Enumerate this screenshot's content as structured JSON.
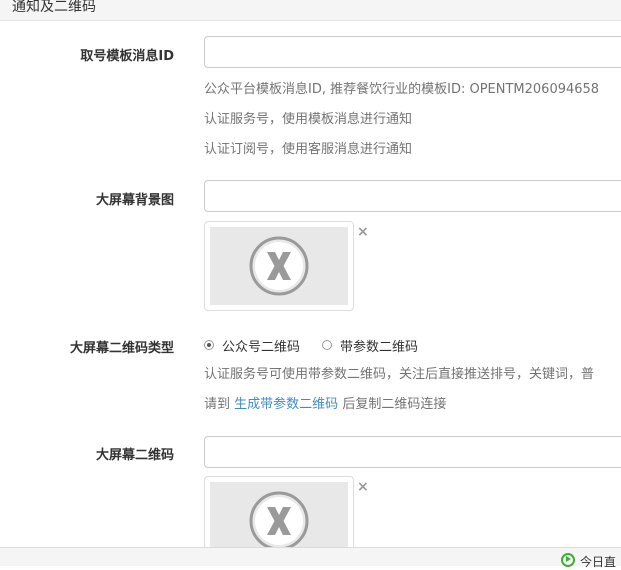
{
  "section": {
    "title": "通知及二维码"
  },
  "template_id": {
    "label": "取号模板消息ID",
    "value": "",
    "help1": "公众平台模板消息ID, 推荐餐饮行业的模板ID: OPENTM206094658",
    "help2": "认证服务号，使用模板消息进行通知",
    "help3": "认证订阅号，使用客服消息进行通知"
  },
  "bg_image": {
    "label": "大屏幕背景图",
    "value": "",
    "preview_icon": "no-image-x-icon",
    "remove_glyph": "×"
  },
  "qr_type": {
    "label": "大屏幕二维码类型",
    "options": [
      {
        "label": "公众号二维码",
        "checked": true
      },
      {
        "label": "带参数二维码",
        "checked": false
      }
    ],
    "help1": "认证服务号可使用带参数二维码，关注后直接推送排号，关键词，普",
    "help2_prefix": "请到",
    "help2_link": "生成带参数二维码",
    "help2_suffix": "后复制二维码连接"
  },
  "qr_image": {
    "label": "大屏幕二维码",
    "value": "",
    "preview_icon": "no-image-x-icon",
    "remove_glyph": "×"
  },
  "footer": {
    "label": "今日直",
    "icon": "play-circle-icon"
  },
  "colors": {
    "link": "#428bca",
    "help": "#737373",
    "accent_green": "#3cb034"
  }
}
